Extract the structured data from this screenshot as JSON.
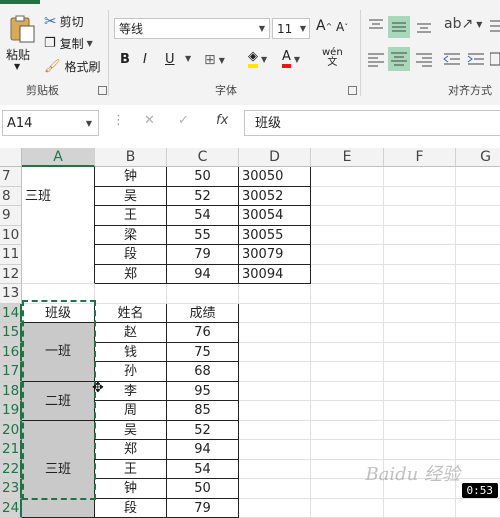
{
  "ribbon": {
    "clipboard": {
      "paste": "粘贴",
      "cut": "剪切",
      "copy": "复制",
      "format_painter": "格式刷",
      "group_label": "剪贴板"
    },
    "font": {
      "font_name": "等线",
      "font_size": "11",
      "bold": "B",
      "italic": "I",
      "underline": "U",
      "phonetic": "wén",
      "group_label": "字体"
    },
    "align": {
      "group_label": "对齐方式"
    }
  },
  "formula_bar": {
    "name_box": "A14",
    "cancel": "✕",
    "enter": "✓",
    "fx": "fx",
    "value": "班级"
  },
  "columns": [
    "A",
    "B",
    "C",
    "D",
    "E",
    "F",
    "G"
  ],
  "rows": [
    {
      "n": "7",
      "a": "",
      "b": "钟",
      "c": "50",
      "d": "30050"
    },
    {
      "n": "8",
      "a": "三班",
      "b": "吴",
      "c": "52",
      "d": "30052"
    },
    {
      "n": "9",
      "a": "",
      "b": "王",
      "c": "54",
      "d": "30054"
    },
    {
      "n": "10",
      "a": "",
      "b": "梁",
      "c": "55",
      "d": "30055"
    },
    {
      "n": "11",
      "a": "",
      "b": "段",
      "c": "79",
      "d": "30079"
    },
    {
      "n": "12",
      "a": "",
      "b": "郑",
      "c": "94",
      "d": "30094"
    },
    {
      "n": "13",
      "a": "",
      "b": "",
      "c": "",
      "d": ""
    },
    {
      "n": "14",
      "a": "班级",
      "b": "姓名",
      "c": "成绩",
      "d": ""
    },
    {
      "n": "15",
      "a": "",
      "b": "赵",
      "c": "76",
      "d": ""
    },
    {
      "n": "16",
      "a": "一班",
      "b": "钱",
      "c": "75",
      "d": ""
    },
    {
      "n": "17",
      "a": "",
      "b": "孙",
      "c": "68",
      "d": ""
    },
    {
      "n": "18",
      "a": "二班",
      "b": "李",
      "c": "95",
      "d": ""
    },
    {
      "n": "19",
      "a": "",
      "b": "周",
      "c": "85",
      "d": ""
    },
    {
      "n": "20",
      "a": "",
      "b": "吴",
      "c": "52",
      "d": ""
    },
    {
      "n": "21",
      "a": "",
      "b": "郑",
      "c": "94",
      "d": ""
    },
    {
      "n": "22",
      "a": "三班",
      "b": "王",
      "c": "54",
      "d": ""
    },
    {
      "n": "23",
      "a": "",
      "b": "钟",
      "c": "50",
      "d": ""
    },
    {
      "n": "24",
      "a": "",
      "b": "段",
      "c": "79",
      "d": ""
    }
  ],
  "overlay": {
    "timer": "0:53",
    "watermark": "Baidu 经验"
  },
  "colors": {
    "accent": "#217346",
    "merged_fill": "#c9c9c9"
  }
}
